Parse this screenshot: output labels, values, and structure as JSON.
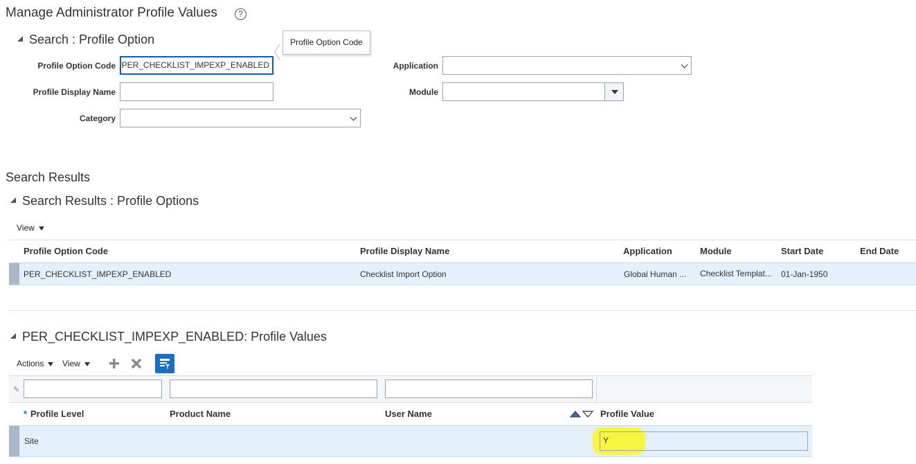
{
  "page": {
    "title": "Manage Administrator Profile Values",
    "help_icon": "question-circle-icon"
  },
  "search": {
    "section_title": "Search : Profile Option",
    "tooltip": "Profile Option Code",
    "fields": {
      "profile_option_code": {
        "label": "Profile Option Code",
        "value": "PER_CHECKLIST_IMPEXP_ENABLED",
        "visible_text": "PER_CHECKLIST_IMPEXP_ENABLED"
      },
      "profile_display_name": {
        "label": "Profile Display Name",
        "value": ""
      },
      "category": {
        "label": "Category",
        "value": ""
      },
      "application": {
        "label": "Application",
        "value": ""
      },
      "module": {
        "label": "Module",
        "value": ""
      }
    }
  },
  "results": {
    "heading": "Search Results",
    "section_title": "Search Results : Profile Options",
    "view_label": "View",
    "columns": [
      "Profile Option Code",
      "Profile Display Name",
      "Application",
      "Module",
      "Start Date",
      "End Date"
    ],
    "rows": [
      {
        "profile_option_code": "PER_CHECKLIST_IMPEXP_ENABLED",
        "profile_display_name": "Checklist Import Option",
        "application": "Global Human ...",
        "module": "Checklist Templat...",
        "start_date": "01-Jan-1950",
        "end_date": ""
      }
    ]
  },
  "values": {
    "section_title": "PER_CHECKLIST_IMPEXP_ENABLED: Profile Values",
    "actions_label": "Actions",
    "view_label": "View",
    "toolbar_icons": [
      "add-icon",
      "delete-icon",
      "query-by-example-icon"
    ],
    "filters": {
      "profile_level": "",
      "product_name": "",
      "user_name": ""
    },
    "required_marker": "*",
    "columns": [
      "Profile Level",
      "Product Name",
      "User Name",
      "Profile Value"
    ],
    "rows": [
      {
        "profile_level": "Site",
        "product_name": "",
        "user_name": "",
        "profile_value": "Y"
      }
    ]
  },
  "colors": {
    "accent_blue": "#1a6fc0",
    "selected_row": "#e4f0fa",
    "highlight_yellow": "#f5f542",
    "focus_border": "#0e5cb5"
  }
}
